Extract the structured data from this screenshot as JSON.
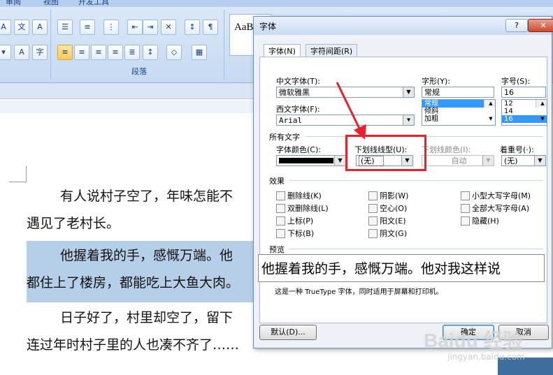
{
  "ribbon": {
    "tabs": [
      "审阅",
      "视图",
      "开发工具"
    ],
    "paragraph_group_label": "段落",
    "style_preview": "AaB"
  },
  "document": {
    "lines": [
      "有人说村子空了，年味怎能不",
      "遇见了老村长。",
      "他握着我的手，感慨万端。他",
      "都住上了楼房，都能吃上大鱼大肉。",
      "日子好了，村里却空了，留下",
      "连过年时村子里的人也凑不齐了……"
    ]
  },
  "dialog": {
    "title": "字体",
    "help": "?",
    "close": "✕",
    "tabs": {
      "font": "字体(N)",
      "spacing": "字符间距(R)"
    },
    "cn_font": {
      "label": "中文字体(T):",
      "value": "微软雅黑"
    },
    "west_font": {
      "label": "西文字体(F):",
      "value": "Arial"
    },
    "style": {
      "label": "字形(Y):",
      "value": "常规",
      "options": [
        "常规",
        "倾斜",
        "加粗"
      ]
    },
    "size": {
      "label": "字号(S):",
      "value": "16",
      "options": [
        "12",
        "14",
        "16"
      ]
    },
    "all_text_label": "所有文字",
    "color": {
      "label": "字体颜色(C):",
      "value": "#000000"
    },
    "underline_style": {
      "label": "下划线线型(U):",
      "value": "(无)"
    },
    "underline_color": {
      "label": "下划线颜色(I):",
      "value": "自动"
    },
    "emphasis": {
      "label": "着重号(·):",
      "value": "(无)"
    },
    "effects_label": "效果",
    "effects": [
      "删除线(K)",
      "双删除线(L)",
      "上标(P)",
      "下标(B)",
      "阴影(W)",
      "空心(O)",
      "阳文(E)",
      "阴文(G)",
      "小型大写字母(M)",
      "全部大写字母(A)",
      "隐藏(H)"
    ],
    "preview_label": "预览",
    "preview_text": "他握着我的手，感慨万端。他对我这样说",
    "footnote": "这是一种 TrueType 字体，同时适用于屏幕和打印机。",
    "buttons": {
      "default": "默认(D)...",
      "ok": "确定",
      "cancel": "取消"
    }
  },
  "watermark": {
    "brand": "Baidu 经验",
    "url": "jingyan.baidu.com"
  },
  "colors": {
    "highlight_box": "#e8222d",
    "selection": "#b6cfe8"
  }
}
